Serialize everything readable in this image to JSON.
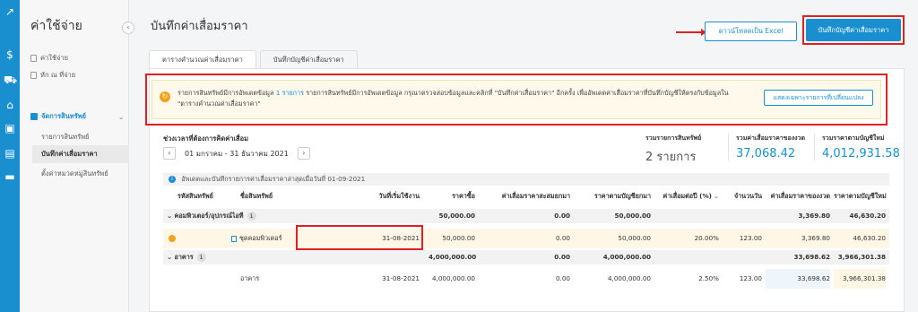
{
  "sidebar": {
    "title": "ค่าใช้จ่าย",
    "items": [
      {
        "label": "ค่าใช้จ่าย"
      },
      {
        "label": "หัก ณ ที่จ่าย"
      }
    ],
    "section": {
      "label": "จัดการสินทรัพย์"
    },
    "sub_items": [
      {
        "label": "รายการสินทรัพย์"
      },
      {
        "label": "บันทึกค่าเสื่อมราคา"
      },
      {
        "label": "ตั้งค่าหมวดหมู่สินทรัพย์"
      }
    ]
  },
  "rail_icons": [
    "chart-icon",
    "dollar-icon",
    "cart-icon",
    "bank-icon",
    "box-icon",
    "cards-icon",
    "briefcase-icon"
  ],
  "header": {
    "title": "บันทึกค่าเสื่อมราคา",
    "download_label": "ดาวน์โหลดเป็น Excel",
    "save_label": "บันทึกบัญชีค่าเสื่อมราคา"
  },
  "tabs": [
    {
      "label": "ตารางคำนวณค่าเสื่อมราคา"
    },
    {
      "label": "บันทึกบัญชีค่าเสื่อมราคา"
    }
  ],
  "notice": {
    "text_before": "รายการสินทรัพย์มีการอัพเดตข้อมูล",
    "link": "1 รายการ",
    "text_after": "รายการสินทรัพย์มีการอัพเดตข้อมูล กรุณาตรวจสอบข้อมูลและคลิกที่ \"บันทึกค่าเสื่อมราคา\" อีกครั้ง เพื่ออัพเดตค่าเสื่อมราคาที่บันทึกบัญชีให้ตรงกับข้อมูลใน \"ตารางคำนวณค่าเสื่อมราคา\"",
    "button_label": "แสดงเฉพาะรายการที่เปลี่ยนแปลง"
  },
  "period": {
    "label": "ช่วงเวลาที่ต้องการคิดค่าเสื่อม",
    "value": "01 มกราคม - 31 ธันวาคม 2021"
  },
  "summary": [
    {
      "label": "รวมรายการสินทรัพย์",
      "value": "2 รายการ",
      "color": "#555555"
    },
    {
      "label": "รวมค่าเสื่อมราคาของงวด",
      "value": "37,068.42",
      "color": "#1a8fd0"
    },
    {
      "label": "รวมราคาตามบัญชีใหม่",
      "value": "4,012,931.58",
      "color": "#1a8fd0"
    }
  ],
  "info": "อัพเดตและบันทึกรายการค่าเสื่อมราคาล่าสุดเมื่อวันที่ 01-09-2021",
  "table": {
    "headers": [
      "รหัสสินทรัพย์",
      "ชื่อสินทรัพย์",
      "วันที่เริ่มใช้งาน",
      "ราคาซื้อ",
      "ค่าเสื่อมราคาสะสมยกมา",
      "ราคาตามบัญชียกมา",
      "ค่าเสื่อมต่อปี (%)",
      "จำนวนวัน",
      "ค่าเสื่อมราคาของงวด",
      "ราคาตามบัญชีใหม่"
    ],
    "groups": [
      {
        "name": "คอมพิวเตอร์/อุปกรณ์ไอที",
        "count": "1",
        "purchase": "50,000.00",
        "accum": "0.00",
        "book_prior": "50,000.00",
        "period_dep": "3,369.80",
        "new_book": "46,630.20",
        "rows": [
          {
            "name": "ชุดคอมพิวเตอร์",
            "start": "31-08-2021",
            "purchase": "50,000.00",
            "accum": "0.00",
            "book_prior": "50,000.00",
            "rate": "20.00%",
            "days": "123.00",
            "period_dep": "3,369.80",
            "new_book": "46,630.20"
          }
        ]
      },
      {
        "name": "อาคาร",
        "count": "1",
        "purchase": "4,000,000.00",
        "accum": "0.00",
        "book_prior": "4,000,000.00",
        "period_dep": "33,698.62",
        "new_book": "3,966,301.38",
        "rows": [
          {
            "name": "อาคาร",
            "start": "31-08-2021",
            "purchase": "4,000,000.00",
            "accum": "0.00",
            "book_prior": "4,000,000.00",
            "rate": "2.50%",
            "days": "123.00",
            "period_dep": "33,698.62",
            "new_book": "3,966,301.38"
          }
        ]
      }
    ]
  }
}
